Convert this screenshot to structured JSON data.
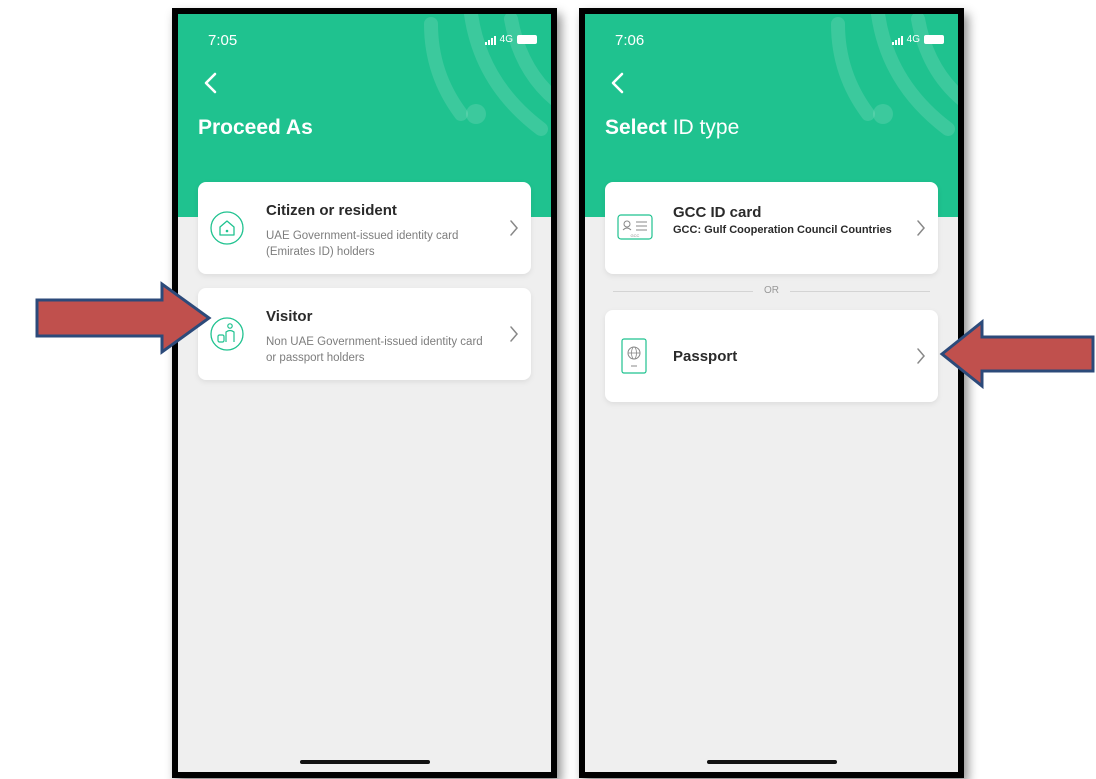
{
  "colors": {
    "brand": "#1fc28f",
    "arrow_fill": "#c0504d",
    "arrow_stroke": "#2c4a7a"
  },
  "left_screen": {
    "status_time": "7:05",
    "network": "4G",
    "title": "Proceed As",
    "options": [
      {
        "icon": "home-icon",
        "title": "Citizen or resident",
        "description": "UAE Government-issued identity card (Emirates ID) holders"
      },
      {
        "icon": "visitor-icon",
        "title": "Visitor",
        "description": "Non UAE Government-issued identity card or passport holders"
      }
    ]
  },
  "right_screen": {
    "status_time": "7:06",
    "network": "4G",
    "title_bold": "Select",
    "title_light": "ID type",
    "gcc": {
      "icon": "id-card-icon",
      "icon_text": "GCC",
      "title": "GCC ID card",
      "description": "GCC: Gulf Cooperation Council Countries"
    },
    "divider": "OR",
    "passport": {
      "icon": "passport-icon",
      "title": "Passport"
    }
  },
  "annotations": [
    {
      "icon": "arrow-right-icon",
      "points_to": "Visitor"
    },
    {
      "icon": "arrow-left-icon",
      "points_to": "Passport"
    }
  ]
}
